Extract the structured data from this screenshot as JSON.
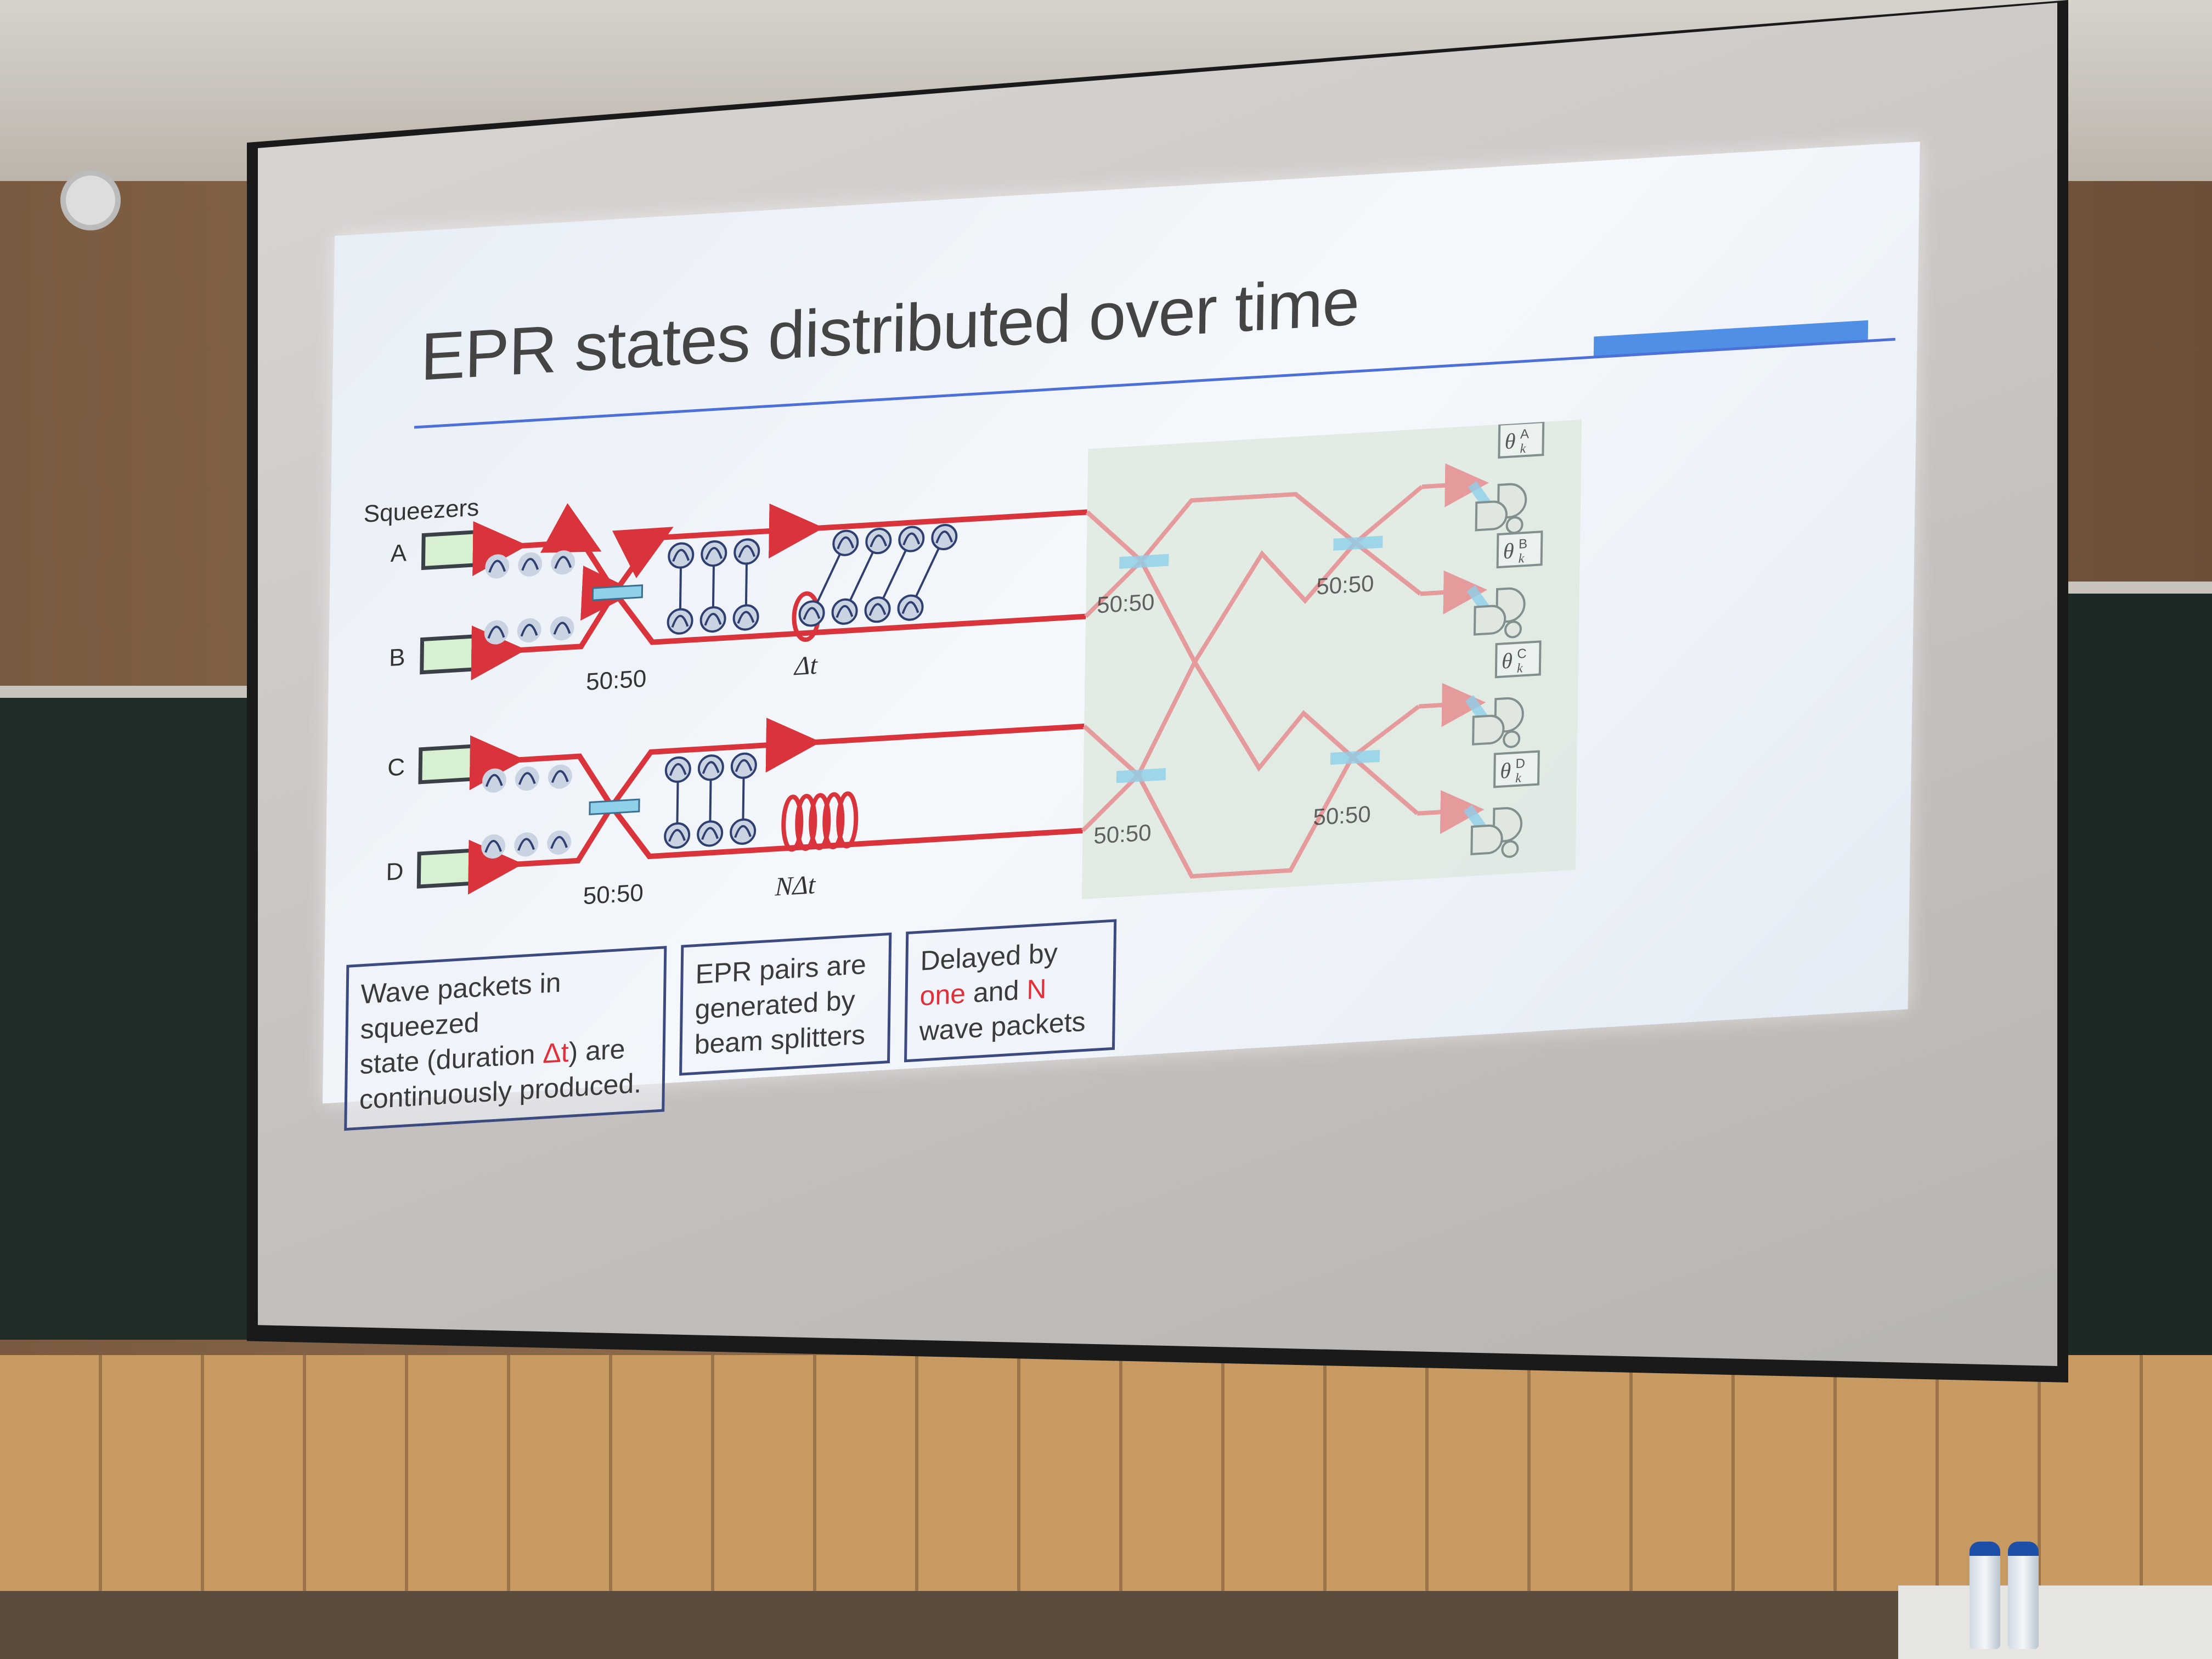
{
  "slide": {
    "title": "EPR states distributed over time"
  },
  "diagram": {
    "squeezers_label": "Squeezers",
    "squeezer_labels": [
      "A",
      "B",
      "C",
      "D"
    ],
    "splitter_label": "50:50",
    "delay_one": "Δt",
    "delay_n": "NΔt",
    "detector_labels": [
      {
        "base": "θ",
        "sub": "k",
        "sup": "A"
      },
      {
        "base": "θ",
        "sub": "k",
        "sup": "B"
      },
      {
        "base": "θ",
        "sub": "k",
        "sup": "C"
      },
      {
        "base": "θ",
        "sub": "k",
        "sup": "D"
      }
    ],
    "beam_color": "#d9343c",
    "splitter_color": "#8fd0ea",
    "faded_region_color": "#dfe9e0"
  },
  "captions": {
    "squeezed": {
      "line1": "Wave packets in squeezed",
      "line2a": "state (duration ",
      "line2b": "Δt",
      "line2c": ") are",
      "line3": "continuously produced."
    },
    "epr": {
      "line1": "EPR pairs are",
      "line2": "generated by",
      "line3": "beam splitters"
    },
    "delay": {
      "line1": "Delayed by",
      "line2a": "one",
      "line2b": " and ",
      "line2c": "N",
      "line3": "wave packets"
    }
  }
}
